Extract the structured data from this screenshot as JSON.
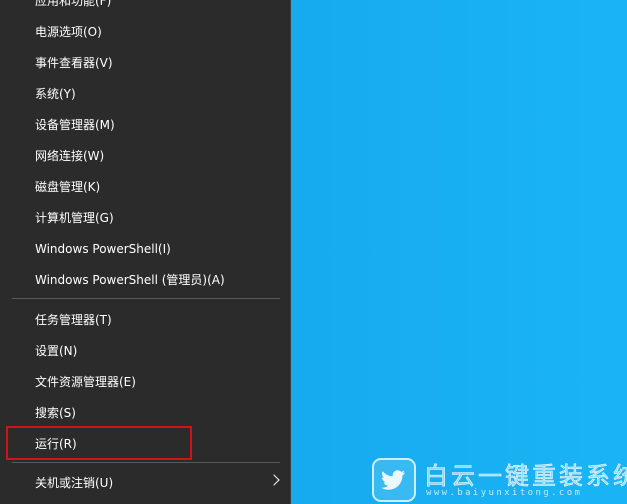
{
  "menu": {
    "items": [
      {
        "label": "应用和功能(F)"
      },
      {
        "label": "电源选项(O)"
      },
      {
        "label": "事件查看器(V)"
      },
      {
        "label": "系统(Y)"
      },
      {
        "label": "设备管理器(M)"
      },
      {
        "label": "网络连接(W)"
      },
      {
        "label": "磁盘管理(K)"
      },
      {
        "label": "计算机管理(G)"
      },
      {
        "label": "Windows PowerShell(I)"
      },
      {
        "label": "Windows PowerShell (管理员)(A)"
      },
      {
        "label": "任务管理器(T)"
      },
      {
        "label": "设置(N)"
      },
      {
        "label": "文件资源管理器(E)"
      },
      {
        "label": "搜索(S)"
      },
      {
        "label": "运行(R)"
      },
      {
        "label": "关机或注销(U)"
      }
    ]
  },
  "watermark": {
    "title": "白云一键重装系统",
    "url": "www.baiyunxitong.com"
  },
  "colors": {
    "menu_background": "#2b2b2b",
    "desktop_blue": "#16aaee",
    "highlight_red": "#d0121b"
  },
  "icons": {
    "submenu_arrow": "chevron-right-icon",
    "watermark_logo": "twitter-bird-icon"
  }
}
